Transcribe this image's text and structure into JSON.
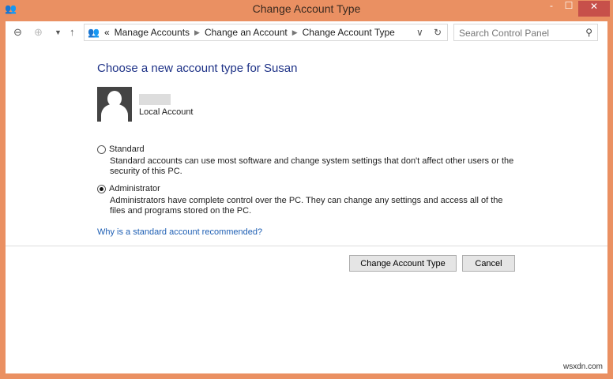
{
  "window": {
    "title": "Change Account Type",
    "minimize": "-",
    "maximize": "☐",
    "close": "✕"
  },
  "nav": {
    "breadcrumb": [
      "Manage Accounts",
      "Change an Account",
      "Change Account Type"
    ],
    "overflow": "«",
    "search_placeholder": "Search Control Panel"
  },
  "main": {
    "heading": "Choose a new account type for Susan",
    "account_type_label": "Local Account",
    "options": [
      {
        "label": "Standard",
        "selected": false,
        "description": "Standard accounts can use most software and change system settings that don't affect other users or the security of this PC."
      },
      {
        "label": "Administrator",
        "selected": true,
        "description": "Administrators have complete control over the PC. They can change any settings and access all of the files and programs stored on the PC."
      }
    ],
    "help_link": "Why is a standard account recommended?",
    "change_button": "Change Account Type",
    "cancel_button": "Cancel"
  },
  "watermark": "wsxdn.com"
}
